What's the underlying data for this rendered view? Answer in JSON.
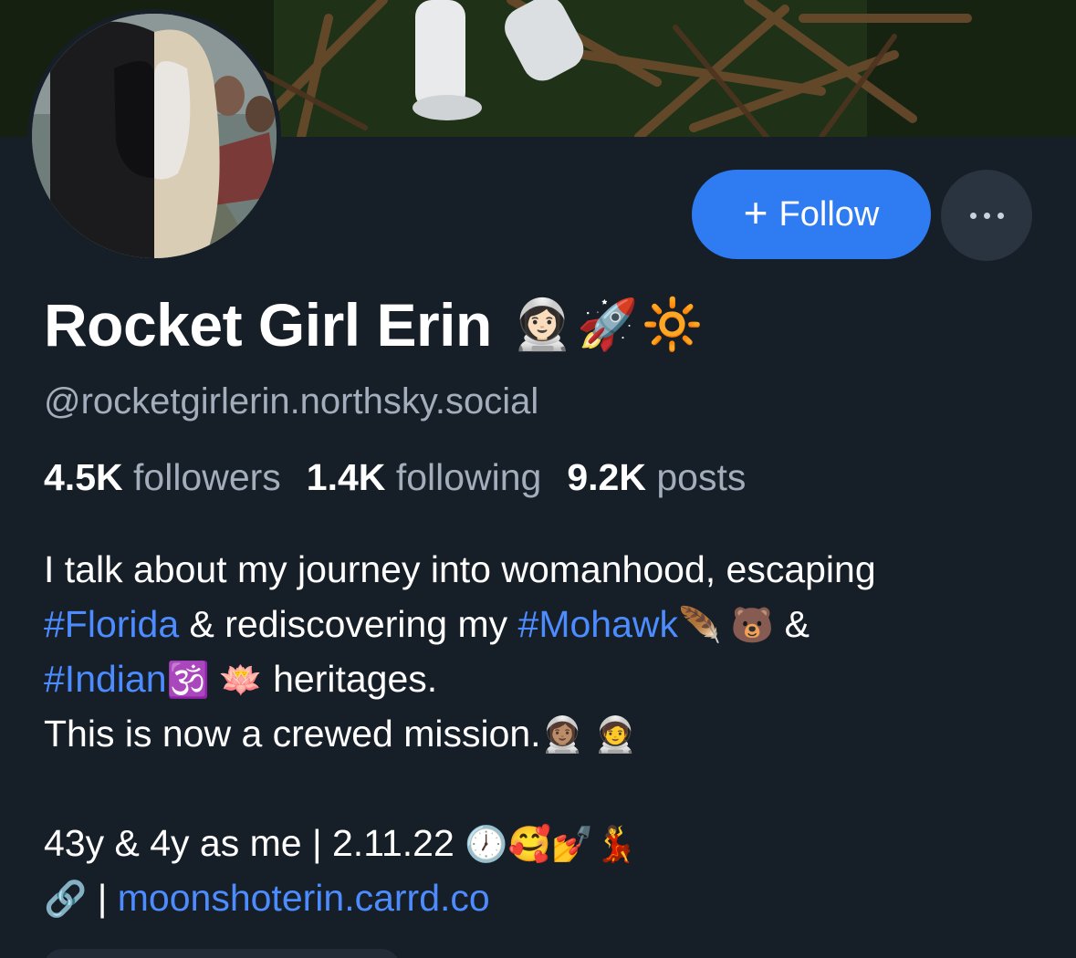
{
  "profile": {
    "display_name": "Rocket Girl Erin",
    "name_emojis": "👩🏻‍🚀🚀🔆",
    "handle": "@rocketgirlerin.northsky.social"
  },
  "actions": {
    "follow_plus": "+",
    "follow_label": "Follow",
    "more_icon": "ellipsis-icon"
  },
  "stats": {
    "followers_count": "4.5K",
    "followers_label": "followers",
    "following_count": "1.4K",
    "following_label": "following",
    "posts_count": "9.2K",
    "posts_label": "posts"
  },
  "bio": {
    "line1": "I talk about my journey into womanhood, escaping",
    "tag_florida": "#Florida",
    "line2_mid": " & rediscovering my ",
    "tag_mohawk": "#Mohawk",
    "line2_emojis": "🪶 🐻",
    "line2_end": " &",
    "tag_indian": "#Indian",
    "line3_emojis": "🕉️ 🪷",
    "line3_end": " heritages.",
    "line4": "This is now a crewed mission.",
    "line4_emojis": "👩🏽‍🚀 🧑‍🚀",
    "line5": "43y & 4y as me | 2.11.22 ",
    "line5_emojis": "🕖🥰💅💃",
    "link_emoji": "🔗",
    "link_sep": " | ",
    "link_text": "moonshoterin.carrd.co"
  },
  "colors": {
    "background": "#161e27",
    "accent": "#2f7bf2",
    "link": "#4c8cff",
    "muted_text": "#a3adbb"
  }
}
